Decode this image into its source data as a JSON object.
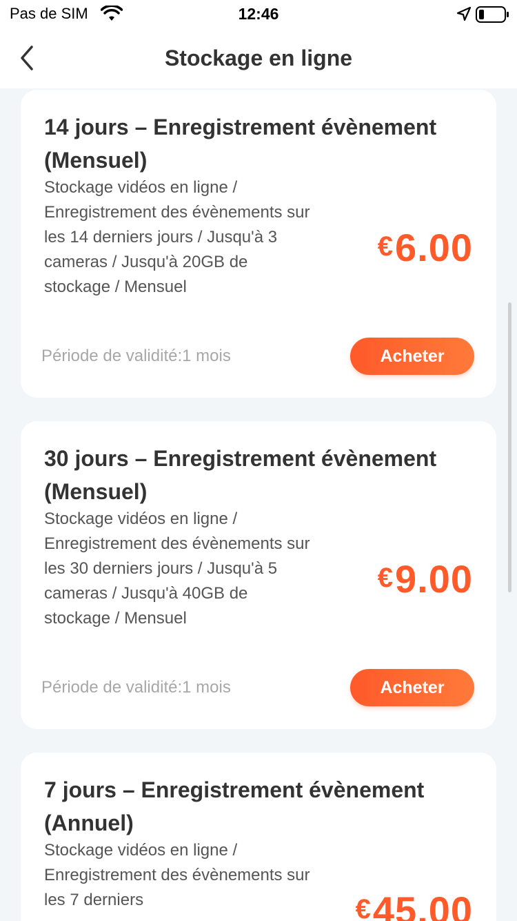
{
  "status_bar": {
    "carrier": "Pas de SIM",
    "time": "12:46"
  },
  "navbar": {
    "title": "Stockage en ligne"
  },
  "colors": {
    "accent": "#ff5a2a",
    "background": "#f3f6f9"
  },
  "plans": [
    {
      "title": "14 jours – Enregistrement évènement (Mensuel)",
      "description": "Stockage vidéos en ligne / Enregistrement des évènements sur les 14 derniers jours / Jusqu'à 3 cameras / Jusqu'à 20GB de stockage / Mensuel",
      "currency": "€",
      "price": "6.00",
      "validity": "Période de validité:1 mois",
      "button": "Acheter"
    },
    {
      "title": "30 jours – Enregistrement évènement (Mensuel)",
      "description": "Stockage vidéos en ligne / Enregistrement des évènements sur les 30 derniers jours / Jusqu'à 5 cameras / Jusqu'à 40GB de stockage / Mensuel",
      "currency": "€",
      "price": "9.00",
      "validity": "Période de validité:1 mois",
      "button": "Acheter"
    },
    {
      "title": "7 jours – Enregistrement évènement (Annuel)",
      "description": "Stockage vidéos en ligne / Enregistrement des évènements sur les 7 derniers",
      "currency": "€",
      "price": "45.00"
    }
  ]
}
